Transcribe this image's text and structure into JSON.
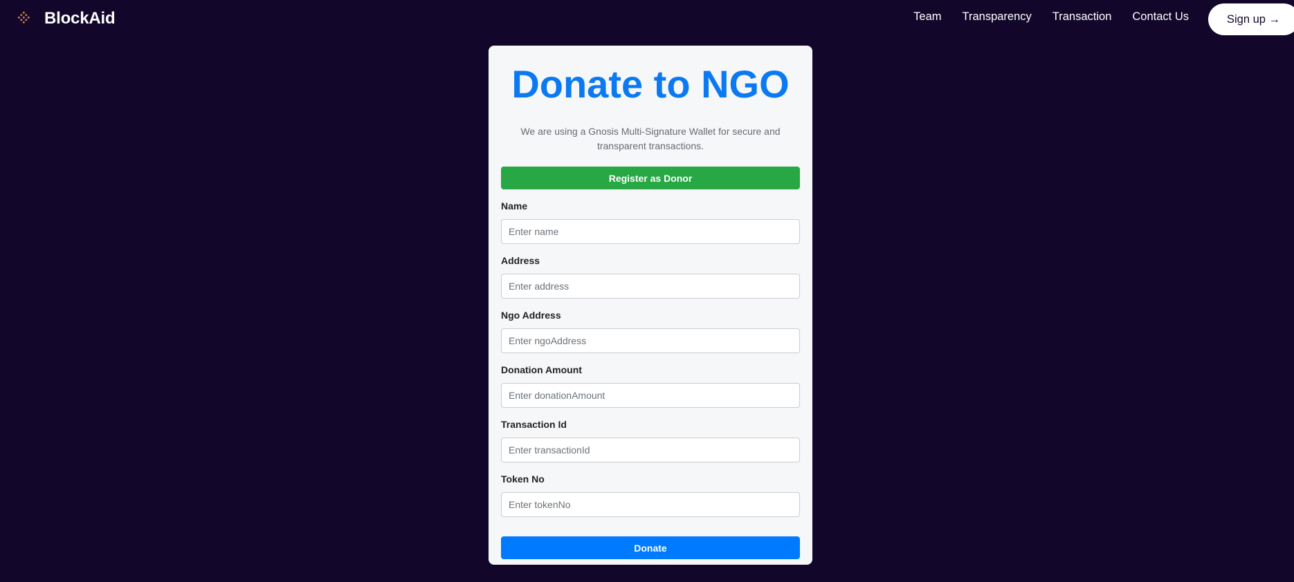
{
  "nav": {
    "brand": "BlockAid",
    "logo_icon": "diamond-grid-logo",
    "links": [
      "Team",
      "Transparency",
      "Transaction",
      "Contact Us"
    ],
    "signup_label": "Sign up →"
  },
  "form": {
    "title": "Donate to NGO",
    "description": "We are using a Gnosis Multi-Signature Wallet for secure and transparent transactions.",
    "register_label": "Register as Donor",
    "fields": [
      {
        "label": "Name",
        "placeholder": "Enter name",
        "value": ""
      },
      {
        "label": "Address",
        "placeholder": "Enter address",
        "value": ""
      },
      {
        "label": "Ngo Address",
        "placeholder": "Enter ngoAddress",
        "value": ""
      },
      {
        "label": "Donation Amount",
        "placeholder": "Enter donationAmount",
        "value": ""
      },
      {
        "label": "Transaction Id",
        "placeholder": "Enter transactionId",
        "value": ""
      },
      {
        "label": "Token No",
        "placeholder": "Enter tokenNo",
        "value": ""
      }
    ],
    "donate_label": "Donate"
  },
  "colors": {
    "background": "#12072b",
    "accent_blue": "#007bff",
    "title_blue": "#0b7af2",
    "register_green": "#28a745",
    "logo_orange": "#d9814a"
  }
}
